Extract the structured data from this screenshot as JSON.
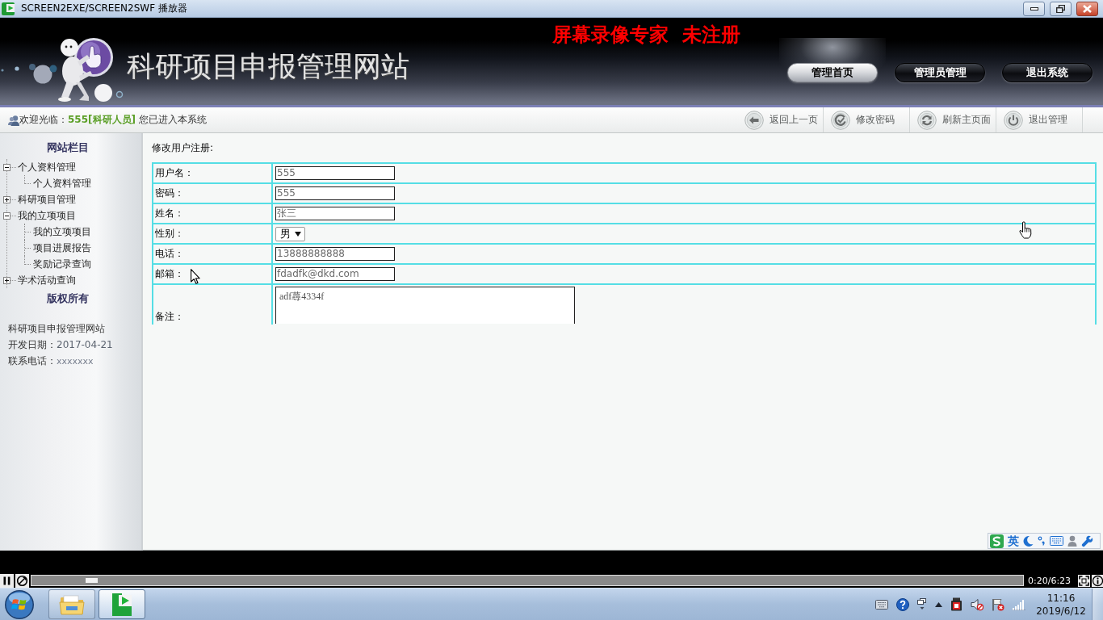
{
  "window": {
    "title": "SCREEN2EXE/SCREEN2SWF 播放器"
  },
  "header": {
    "site_title": "科研项目申报管理网站",
    "recorder_notice": "屏幕录像专家  未注册",
    "nav": [
      {
        "label": "管理首页",
        "selected": true
      },
      {
        "label": "管理员管理",
        "selected": false
      },
      {
        "label": "退出系统",
        "selected": false
      }
    ]
  },
  "welcome_bar": {
    "text": "欢迎光临：**555[科研人员]** 您已进入本系统",
    "toolbar": [
      {
        "kind": "back",
        "label": "返回上一页"
      },
      {
        "kind": "password",
        "label": "修改密码"
      },
      {
        "kind": "refresh",
        "label": "刷新主页面"
      },
      {
        "kind": "power",
        "label": "退出管理"
      }
    ]
  },
  "sidebar": {
    "heading": "网站栏目",
    "tree": [
      {
        "label": "个人资料管理",
        "expanded": true,
        "children": [
          {
            "label": "个人资料管理"
          }
        ]
      },
      {
        "label": "科研项目管理",
        "expanded": false
      },
      {
        "label": "我的立项项目",
        "expanded": true,
        "children": [
          {
            "label": "我的立项项目"
          },
          {
            "label": "项目进展报告"
          },
          {
            "label": "奖励记录查询"
          }
        ]
      },
      {
        "label": "学术活动查询",
        "expanded": false
      }
    ],
    "footer_heading": "版权所有",
    "info": [
      {
        "label": "科研项目申报管理网站"
      },
      {
        "label": "开发日期：",
        "value": "2017-04-21"
      },
      {
        "label": "联系电话：",
        "value": "xxxxxxx"
      }
    ]
  },
  "form": {
    "title": "修改用户注册:",
    "fields": [
      {
        "label": "用户名：",
        "kind": "text",
        "value": "555"
      },
      {
        "label": "密码：",
        "kind": "text",
        "value": "555"
      },
      {
        "label": "姓名：",
        "kind": "text",
        "value": "张三"
      },
      {
        "label": "性别：",
        "kind": "select",
        "value": "男"
      },
      {
        "label": "电话：",
        "kind": "text",
        "value": "13888888888"
      },
      {
        "label": "邮箱：",
        "kind": "text",
        "value": "fdadfk@dkd.com"
      },
      {
        "label": "备注：",
        "kind": "textarea",
        "value": "adf蕁4334f"
      }
    ]
  },
  "ime_bar": {
    "mode": "英"
  },
  "player": {
    "playing": true,
    "level": 0.06,
    "time": "0:20/6:23"
  },
  "taskbar": {
    "apps": [
      {
        "kind": "explorer",
        "selected": false
      },
      {
        "kind": "player",
        "selected": true
      }
    ],
    "clock": {
      "time": "11:16",
      "date": "2019/6/12"
    }
  }
}
